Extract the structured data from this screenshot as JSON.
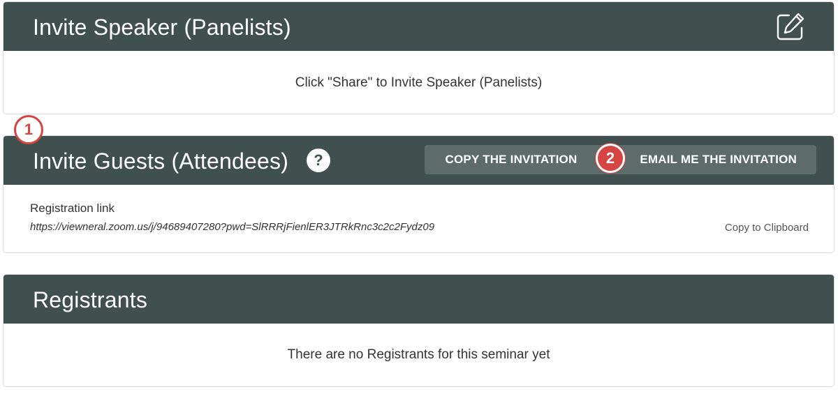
{
  "speaker_panel": {
    "title": "Invite Speaker (Panelists)",
    "body_text": "Click \"Share\" to Invite Speaker (Panelists)",
    "edit_icon": "edit-icon"
  },
  "guests_panel": {
    "title": "Invite Guests (Attendees)",
    "help_icon_glyph": "?",
    "copy_button": "COPY THE INVITATION",
    "email_button": "EMAIL ME THE INVITATION",
    "registration_label": "Registration link",
    "registration_url": "https://viewneral.zoom.us/j/94689407280?pwd=SlRRRjFienlER3JTRkRnc3c2c2Fydz09",
    "clipboard_link": "Copy to Clipboard"
  },
  "registrants_panel": {
    "title": "Registrants",
    "empty_text": "There are no Registrants for this seminar yet"
  },
  "markers": {
    "step_1": "1",
    "step_2": "2"
  },
  "colors": {
    "header_bg": "#3f504e",
    "button_bg": "#5d6c6a",
    "marker_red": "#d64541"
  }
}
